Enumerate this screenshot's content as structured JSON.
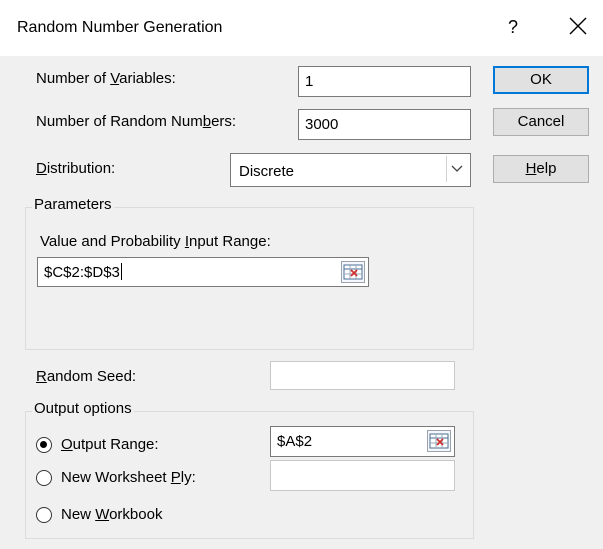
{
  "dialog": {
    "title": "Random Number Generation",
    "help_glyph": "?",
    "close_icon": "close-icon"
  },
  "fields": {
    "num_variables_pre": "Number of ",
    "num_variables_ul": "V",
    "num_variables_post": "ariables:",
    "num_variables_value": "1",
    "num_random_pre": "Number of Random Num",
    "num_random_ul": "b",
    "num_random_post": "ers:",
    "num_random_value": "3000",
    "distribution_ul": "D",
    "distribution_post": "istribution:",
    "distribution_value": "Discrete"
  },
  "buttons": {
    "ok": "OK",
    "cancel": "Cancel",
    "help_ul": "H",
    "help_post": "elp"
  },
  "parameters": {
    "group_title": "Parameters",
    "range_pre": "Value and Probability ",
    "range_ul": "I",
    "range_post": "nput Range:",
    "range_value": "$C$2:$D$3"
  },
  "seed": {
    "label_ul": "R",
    "label_post": "andom Seed:",
    "value": ""
  },
  "output": {
    "group_title": "Output options",
    "output_range_ul": "O",
    "output_range_post": "utput Range:",
    "output_range_value": "$A$2",
    "output_range_checked": true,
    "new_sheet_pre": "New Worksheet ",
    "new_sheet_ul": "P",
    "new_sheet_post": "ly:",
    "new_sheet_value": "",
    "new_workbook_pre": "New ",
    "new_workbook_ul": "W",
    "new_workbook_post": "orkbook"
  },
  "colors": {
    "accent": "#0078d7",
    "background": "#f0f0f0"
  }
}
